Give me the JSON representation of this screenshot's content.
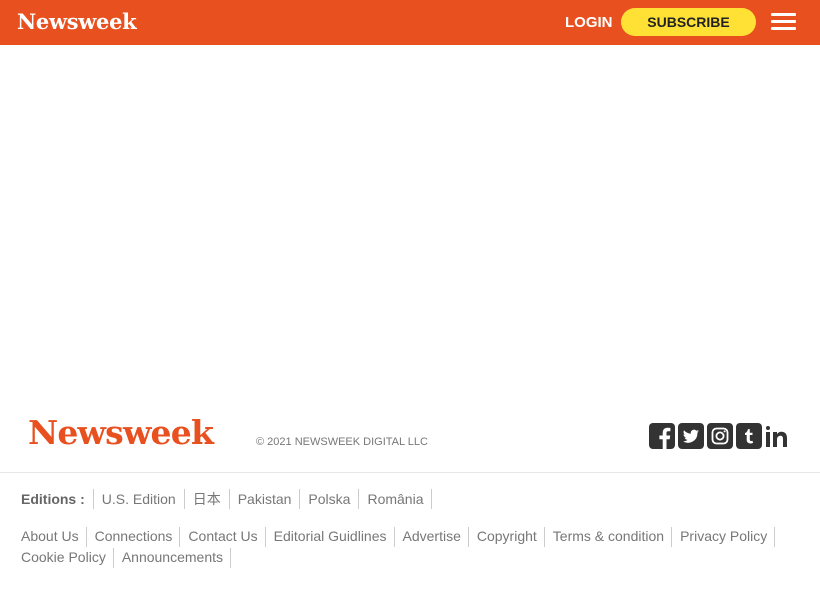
{
  "header": {
    "logo": "Newsweek",
    "login_label": "LOGIN",
    "subscribe_label": "SUBSCRIBE",
    "menu_icon": "hamburger-menu-icon"
  },
  "footer": {
    "logo": "Newsweek",
    "copyright": "© 2021 NEWSWEEK DIGITAL LLC",
    "social": [
      "facebook-icon",
      "twitter-icon",
      "instagram-icon",
      "tumblr-icon",
      "linkedin-icon"
    ],
    "editions_label": "Editions :",
    "editions": [
      "U.S. Edition",
      "日本",
      "Pakistan",
      "Polska",
      "România"
    ],
    "links": [
      "About Us",
      "Connections",
      "Contact Us",
      "Editorial Guidlines",
      "Advertise",
      "Copyright",
      "Terms & condition",
      "Privacy Policy",
      "Cookie Policy",
      "Announcements"
    ]
  },
  "colors": {
    "brand": "#e8511f",
    "subscribe": "#ffe135",
    "social_icon": "#333333"
  }
}
